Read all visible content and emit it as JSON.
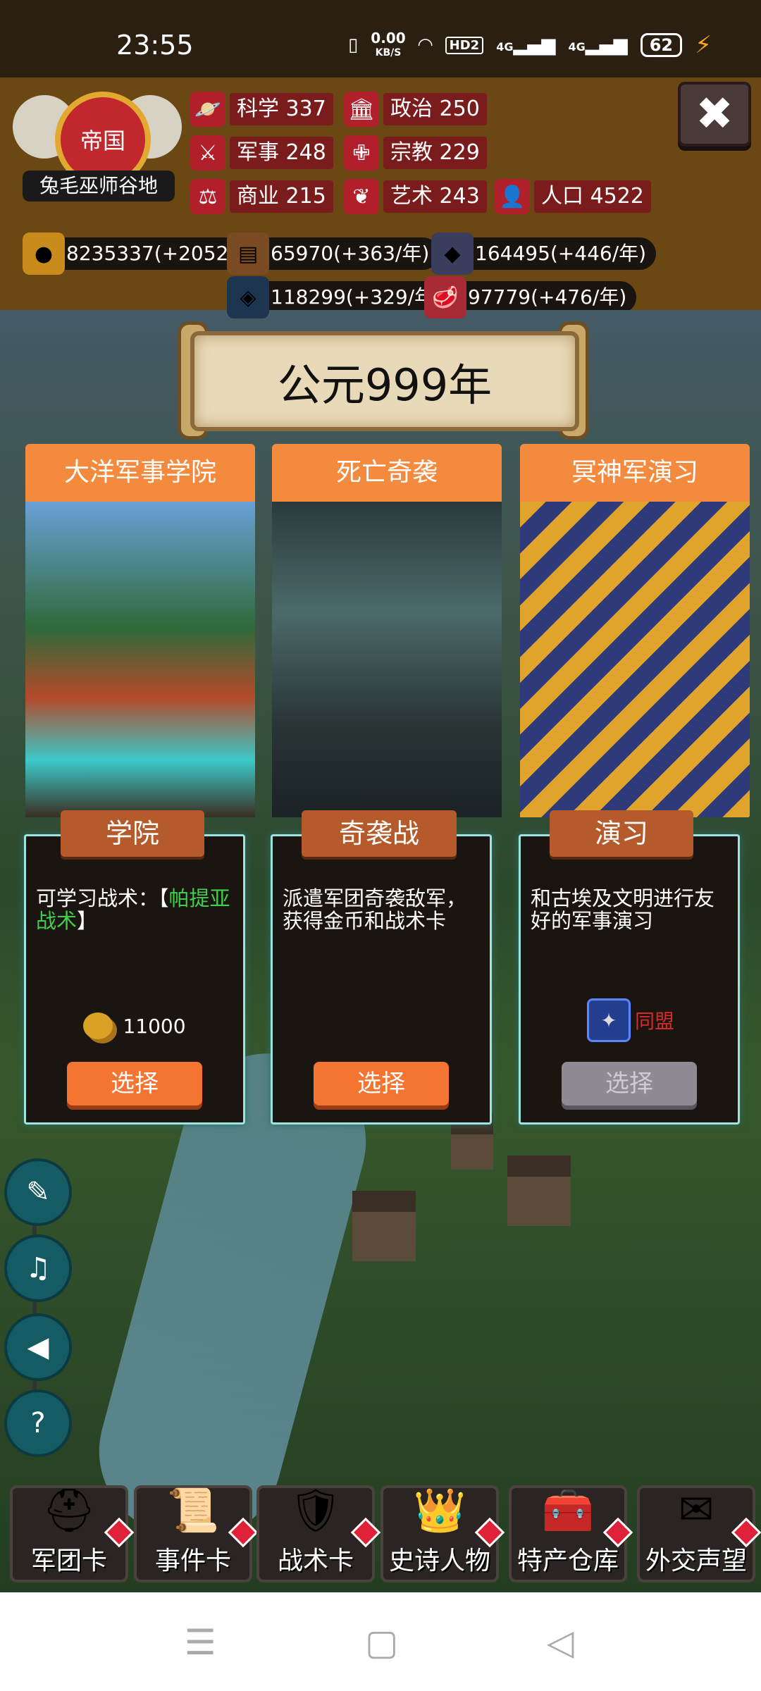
{
  "status_bar": {
    "time": "23:55",
    "net_speed_value": "0.00",
    "net_speed_unit": "KB/S",
    "hd": "HD2",
    "signal1": "4G",
    "signal2": "4G",
    "battery": "62"
  },
  "nation": {
    "type": "帝国",
    "name": "兔毛巫师谷地"
  },
  "stats": {
    "science": {
      "label": "科学",
      "value": "337"
    },
    "politics": {
      "label": "政治",
      "value": "250"
    },
    "military": {
      "label": "军事",
      "value": "248"
    },
    "religion": {
      "label": "宗教",
      "value": "229"
    },
    "commerce": {
      "label": "商业",
      "value": "215"
    },
    "art": {
      "label": "艺术",
      "value": "243"
    },
    "population": {
      "label": "人口",
      "value": "4522"
    }
  },
  "resources": {
    "gold": "8235337(+20521/年",
    "wood": "65970(+363/年)",
    "ore": "164495(+446/年)",
    "crystal": "118299(+329/年)",
    "meat": "97779(+476/年)"
  },
  "year_banner": "公元999年",
  "cards": [
    {
      "title": "大洋军事学院",
      "tag": "学院",
      "desc_prefix": "可学习战术：【",
      "desc_highlight": "帕提亚战术",
      "desc_suffix": "】",
      "cost": "11000",
      "button": "选择"
    },
    {
      "title": "死亡奇袭",
      "tag": "奇袭战",
      "desc": "派遣军团奇袭敌军，获得金币和战术卡",
      "button": "选择"
    },
    {
      "title": "冥神军演习",
      "tag": "演习",
      "desc": "和古埃及文明进行友好的军事演习",
      "ally_label": "同盟",
      "button": "选择"
    }
  ],
  "bottom_menu": [
    {
      "label": "军团卡",
      "icon": "helmet-icon"
    },
    {
      "label": "事件卡",
      "icon": "scroll-icon"
    },
    {
      "label": "战术卡",
      "icon": "shield-swords-icon"
    },
    {
      "label": "史诗人物",
      "icon": "crown-icon"
    },
    {
      "label": "特产仓库",
      "icon": "chest-icon"
    },
    {
      "label": "外交声望",
      "icon": "envelope-icon"
    }
  ],
  "colors": {
    "card_title": "#f48a3d",
    "button": "#f47432",
    "disabled_button": "#8e8b93",
    "highlight_text": "#3fcf4a",
    "ally_text": "#d82a2a"
  }
}
